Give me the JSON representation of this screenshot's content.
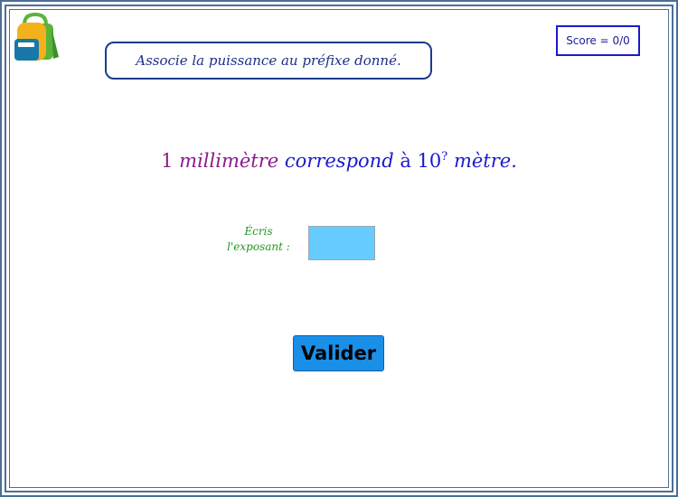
{
  "instruction": "Associe la puissance au préfixe donné.",
  "score": "Score = 0/0",
  "question": {
    "number": "1",
    "unit": "millimètre",
    "verb": "correspond",
    "preposition": "à",
    "base": "10",
    "exponent": "?",
    "ending": "mètre."
  },
  "exponent_label": {
    "line1": "Écris",
    "line2": "l'exposant :"
  },
  "exponent_input": {
    "value": "",
    "color": "#66ccff"
  },
  "validate_button": "Valider",
  "icons": {
    "logo": "backpack-icon"
  },
  "colors": {
    "frame": "#4a6f98",
    "instruction_text": "#1a2f8a",
    "unit_text": "#8a1a8a",
    "question_text": "#1a1acc",
    "label_text": "#1f9a1f",
    "button": "#1a8fe8"
  }
}
